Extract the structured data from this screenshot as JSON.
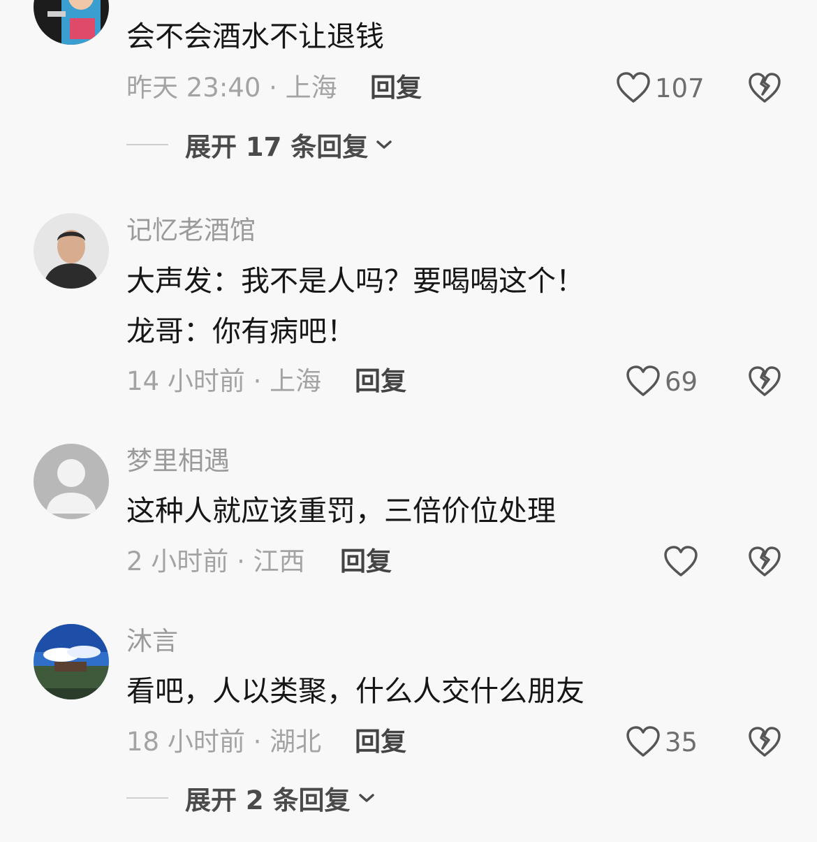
{
  "comments": [
    {
      "username": "",
      "lines": [
        "会不会酒水不让退钱"
      ],
      "meta": "昨天 23:40 · 上海",
      "reply_label": "回复",
      "likes": "107",
      "expand": "展开 17 条回复"
    },
    {
      "username": "记忆老酒馆",
      "lines": [
        "大声发：我不是人吗？要喝喝这个！",
        "龙哥：你有病吧！"
      ],
      "meta": "14 小时前 · 上海",
      "reply_label": "回复",
      "likes": "69"
    },
    {
      "username": "梦里相遇",
      "lines": [
        "这种人就应该重罚，三倍价位处理"
      ],
      "meta": "2 小时前 · 江西",
      "reply_label": "回复",
      "likes": ""
    },
    {
      "username": "沐言",
      "lines": [
        "看吧，人以类聚，什么人交什么朋友"
      ],
      "meta": "18 小时前 · 湖北",
      "reply_label": "回复",
      "likes": "35",
      "expand": "展开 2 条回复"
    }
  ],
  "icons": {
    "like": "heart-outline-icon",
    "dislike": "broken-heart-icon",
    "expand": "chevron-down-icon"
  },
  "colors": {
    "background": "#f8f8f8",
    "text": "#161616",
    "secondary": "#a3a3a3"
  }
}
